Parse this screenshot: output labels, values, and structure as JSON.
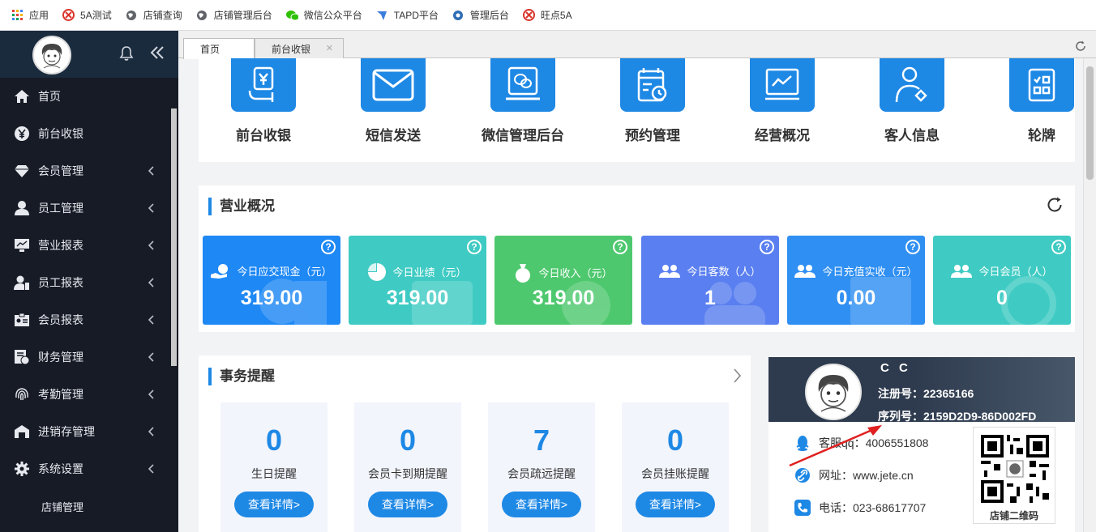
{
  "bookmarks": [
    {
      "label": "应用",
      "icon": "apps-grid-icon"
    },
    {
      "label": "5A测试",
      "icon": "5a-logo-icon"
    },
    {
      "label": "店铺查询",
      "icon": "globe-icon"
    },
    {
      "label": "店铺管理后台",
      "icon": "globe-icon"
    },
    {
      "label": "微信公众平台",
      "icon": "wechat-icon"
    },
    {
      "label": "TAPD平台",
      "icon": "tapd-icon"
    },
    {
      "label": "管理后台",
      "icon": "gear-globe-icon"
    },
    {
      "label": "旺点5A",
      "icon": "5a-logo-icon"
    }
  ],
  "sidebar": {
    "items": [
      {
        "label": "首页",
        "icon": "home-icon",
        "has_children": false
      },
      {
        "label": "前台收银",
        "icon": "yen-icon",
        "has_children": false
      },
      {
        "label": "会员管理",
        "icon": "diamond-icon",
        "has_children": true
      },
      {
        "label": "员工管理",
        "icon": "user-icon",
        "has_children": true
      },
      {
        "label": "营业报表",
        "icon": "monitor-icon",
        "has_children": true
      },
      {
        "label": "员工报表",
        "icon": "user-report-icon",
        "has_children": true
      },
      {
        "label": "会员报表",
        "icon": "id-card-icon",
        "has_children": true
      },
      {
        "label": "财务管理",
        "icon": "finance-icon",
        "has_children": true
      },
      {
        "label": "考勤管理",
        "icon": "fingerprint-icon",
        "has_children": true
      },
      {
        "label": "进销存管理",
        "icon": "warehouse-icon",
        "has_children": true
      },
      {
        "label": "系统设置",
        "icon": "gear-icon",
        "has_children": true
      }
    ],
    "sub_item": "店铺管理"
  },
  "tabs": [
    {
      "label": "首页",
      "active": true
    },
    {
      "label": "前台收银",
      "active": false
    }
  ],
  "quick_links": [
    {
      "label": "前台收银",
      "icon": "cashier-icon"
    },
    {
      "label": "短信发送",
      "icon": "envelope-icon"
    },
    {
      "label": "微信管理后台",
      "icon": "wechat-screen-icon"
    },
    {
      "label": "预约管理",
      "icon": "calendar-clock-icon"
    },
    {
      "label": "经营概况",
      "icon": "line-chart-icon"
    },
    {
      "label": "客人信息",
      "icon": "customer-icon"
    },
    {
      "label": "轮牌",
      "icon": "rotation-board-icon"
    }
  ],
  "overview": {
    "title": "营业概况",
    "cards": [
      {
        "label": "今日应交现金（元）",
        "value": "319.00",
        "color": "#1e88f5",
        "icon": "cash-hand-icon"
      },
      {
        "label": "今日业绩（元）",
        "value": "319.00",
        "color": "#3fcbc3",
        "icon": "pie-chart-icon"
      },
      {
        "label": "今日收入（元）",
        "value": "319.00",
        "color": "#4ec86e",
        "icon": "money-bag-icon"
      },
      {
        "label": "今日客数（人）",
        "value": "1",
        "color": "#5a7ff0",
        "icon": "group-icon"
      },
      {
        "label": "今日充值实收（元）",
        "value": "0.00",
        "color": "#2f8ff2",
        "icon": "group-icon"
      },
      {
        "label": "今日会员（人）",
        "value": "0",
        "color": "#3fcbc3",
        "icon": "group-icon"
      }
    ]
  },
  "reminders": {
    "title": "事务提醒",
    "button_label": "查看详情>",
    "items": [
      {
        "count": "0",
        "label": "生日提醒"
      },
      {
        "count": "0",
        "label": "会员卡到期提醒"
      },
      {
        "count": "7",
        "label": "会员疏远提醒"
      },
      {
        "count": "0",
        "label": "会员挂账提醒"
      }
    ]
  },
  "store": {
    "name": "C C",
    "reg_label": "注册号：22365166",
    "serial_label": "序列号：2159D2D9-86D002FD",
    "qq": "客服qq：4006551808",
    "website": "网址：www.jete.cn",
    "phone": "电话：023-68617707",
    "qr_caption": "店铺二维码"
  }
}
